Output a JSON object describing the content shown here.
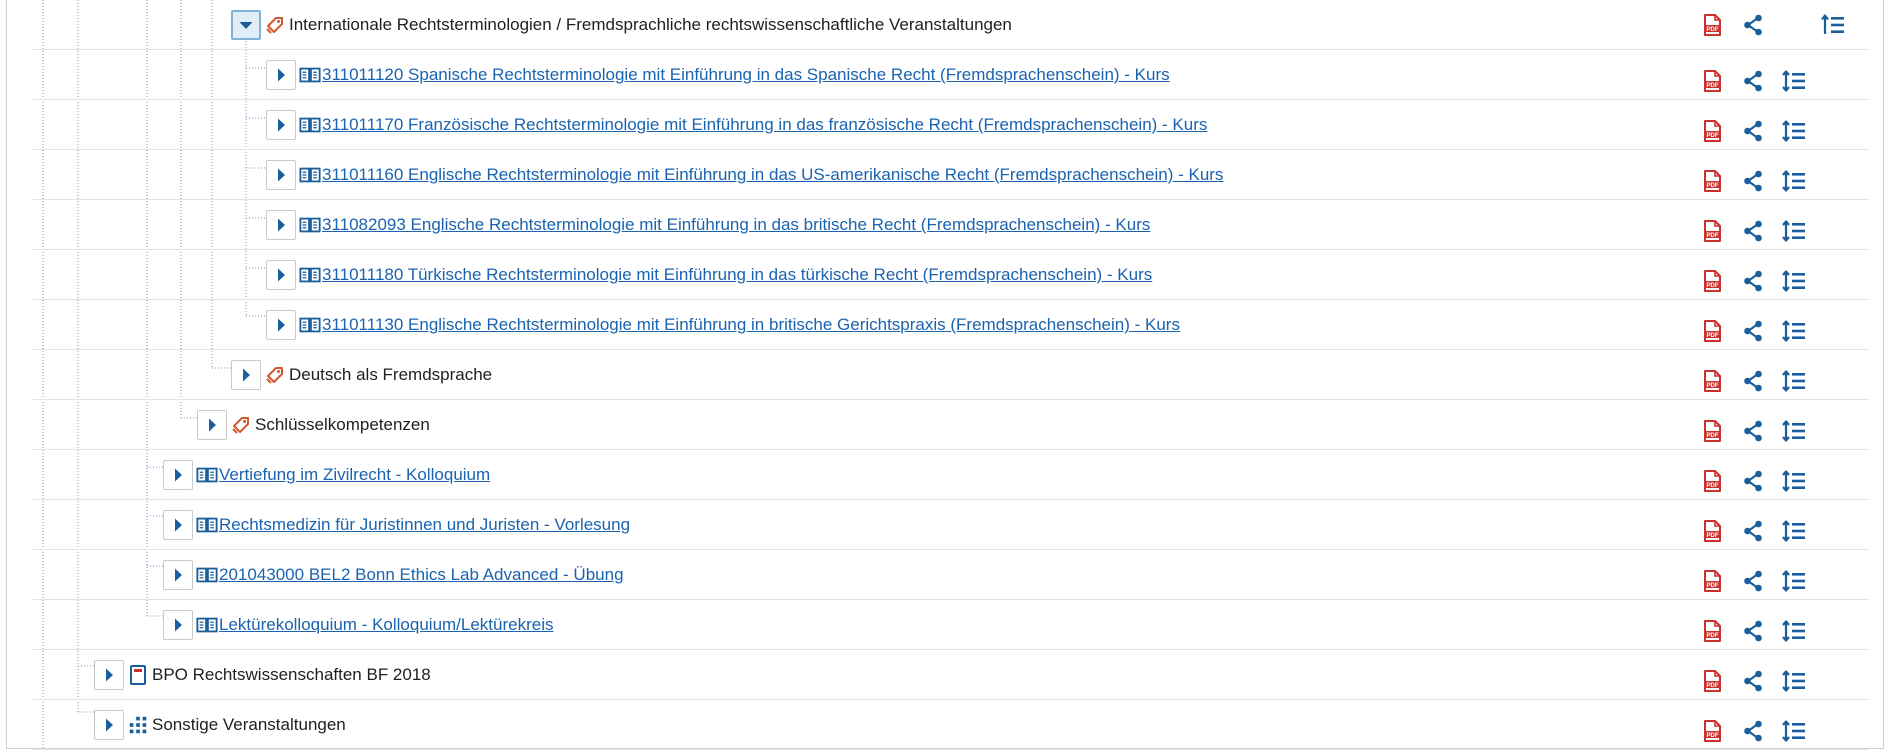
{
  "colors": {
    "accent": "#1b5e9c",
    "link": "#1a63b0",
    "pdf": "#c9312c",
    "tag": "#d4582f"
  },
  "rows": [
    {
      "label": "Internationale Rechtsterminologien / Fremdsprachliche rechtswissenschaftliche Veranstaltungen",
      "icon": "tag-icon",
      "link": false,
      "expanded": true
    },
    {
      "label": "311011120 Spanische Rechtsterminologie mit Einführung in das Spanische Recht (Fremdsprachenschein) - Kurs",
      "icon": "book-icon",
      "link": true
    },
    {
      "label": "311011170 Französische Rechtsterminologie mit Einführung in das französische Recht (Fremdsprachenschein) - Kurs",
      "icon": "book-icon",
      "link": true
    },
    {
      "label": "311011160 Englische Rechtsterminologie mit Einführung in das US-amerikanische Recht (Fremdsprachenschein) - Kurs",
      "icon": "book-icon",
      "link": true
    },
    {
      "label": "311082093 Englische Rechtsterminologie mit Einführung in das britische Recht (Fremdsprachenschein) - Kurs",
      "icon": "book-icon",
      "link": true
    },
    {
      "label": "311011180 Türkische Rechtsterminologie mit Einführung in das türkische Recht (Fremdsprachenschein) - Kurs",
      "icon": "book-icon",
      "link": true
    },
    {
      "label": "311011130 Englische Rechtsterminologie mit Einführung in britische Gerichtspraxis (Fremdsprachenschein) - Kurs",
      "icon": "book-icon",
      "link": true
    },
    {
      "label": "Deutsch als Fremdsprache",
      "icon": "tag-icon",
      "link": false
    },
    {
      "label": "Schlüsselkompetenzen",
      "icon": "tag-icon",
      "link": false
    },
    {
      "label": "Vertiefung im Zivilrecht - Kolloquium",
      "icon": "book-icon",
      "link": true
    },
    {
      "label": "Rechtsmedizin für Juristinnen und Juristen - Vorlesung",
      "icon": "book-icon",
      "link": true
    },
    {
      "label": "201043000 BEL2 Bonn Ethics Lab Advanced - Übung",
      "icon": "book-icon",
      "link": true
    },
    {
      "label": "Lektürekolloquium - Kolloquium/Lektürekreis",
      "icon": "book-icon",
      "link": true
    },
    {
      "label": "BPO Rechtswissenschaften BF 2018",
      "icon": "document-icon",
      "link": false
    },
    {
      "label": "Sonstige Veranstaltungen",
      "icon": "hierarchy-icon",
      "link": false
    }
  ],
  "actions": [
    "pdf-icon",
    "share-icon",
    "reorder-icon"
  ]
}
